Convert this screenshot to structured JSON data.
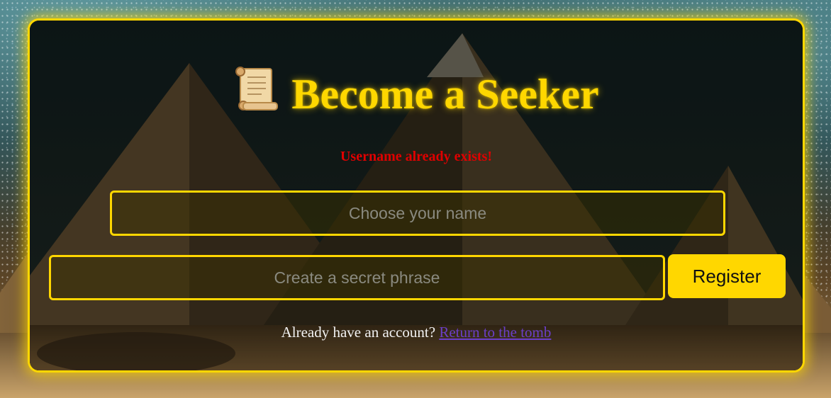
{
  "page": {
    "title": "Become a Seeker",
    "title_icon": "scroll-icon",
    "error_message": "Username already exists!"
  },
  "form": {
    "username_placeholder": "Choose your name",
    "username_value": "",
    "password_placeholder": "Create a secret phrase",
    "password_value": "",
    "register_label": "Register"
  },
  "footer": {
    "prompt": "Already have an account?",
    "link_label": "Return to the tomb"
  },
  "colors": {
    "accent": "#ffd700",
    "error": "#e00000",
    "link": "#6b3fc7"
  }
}
